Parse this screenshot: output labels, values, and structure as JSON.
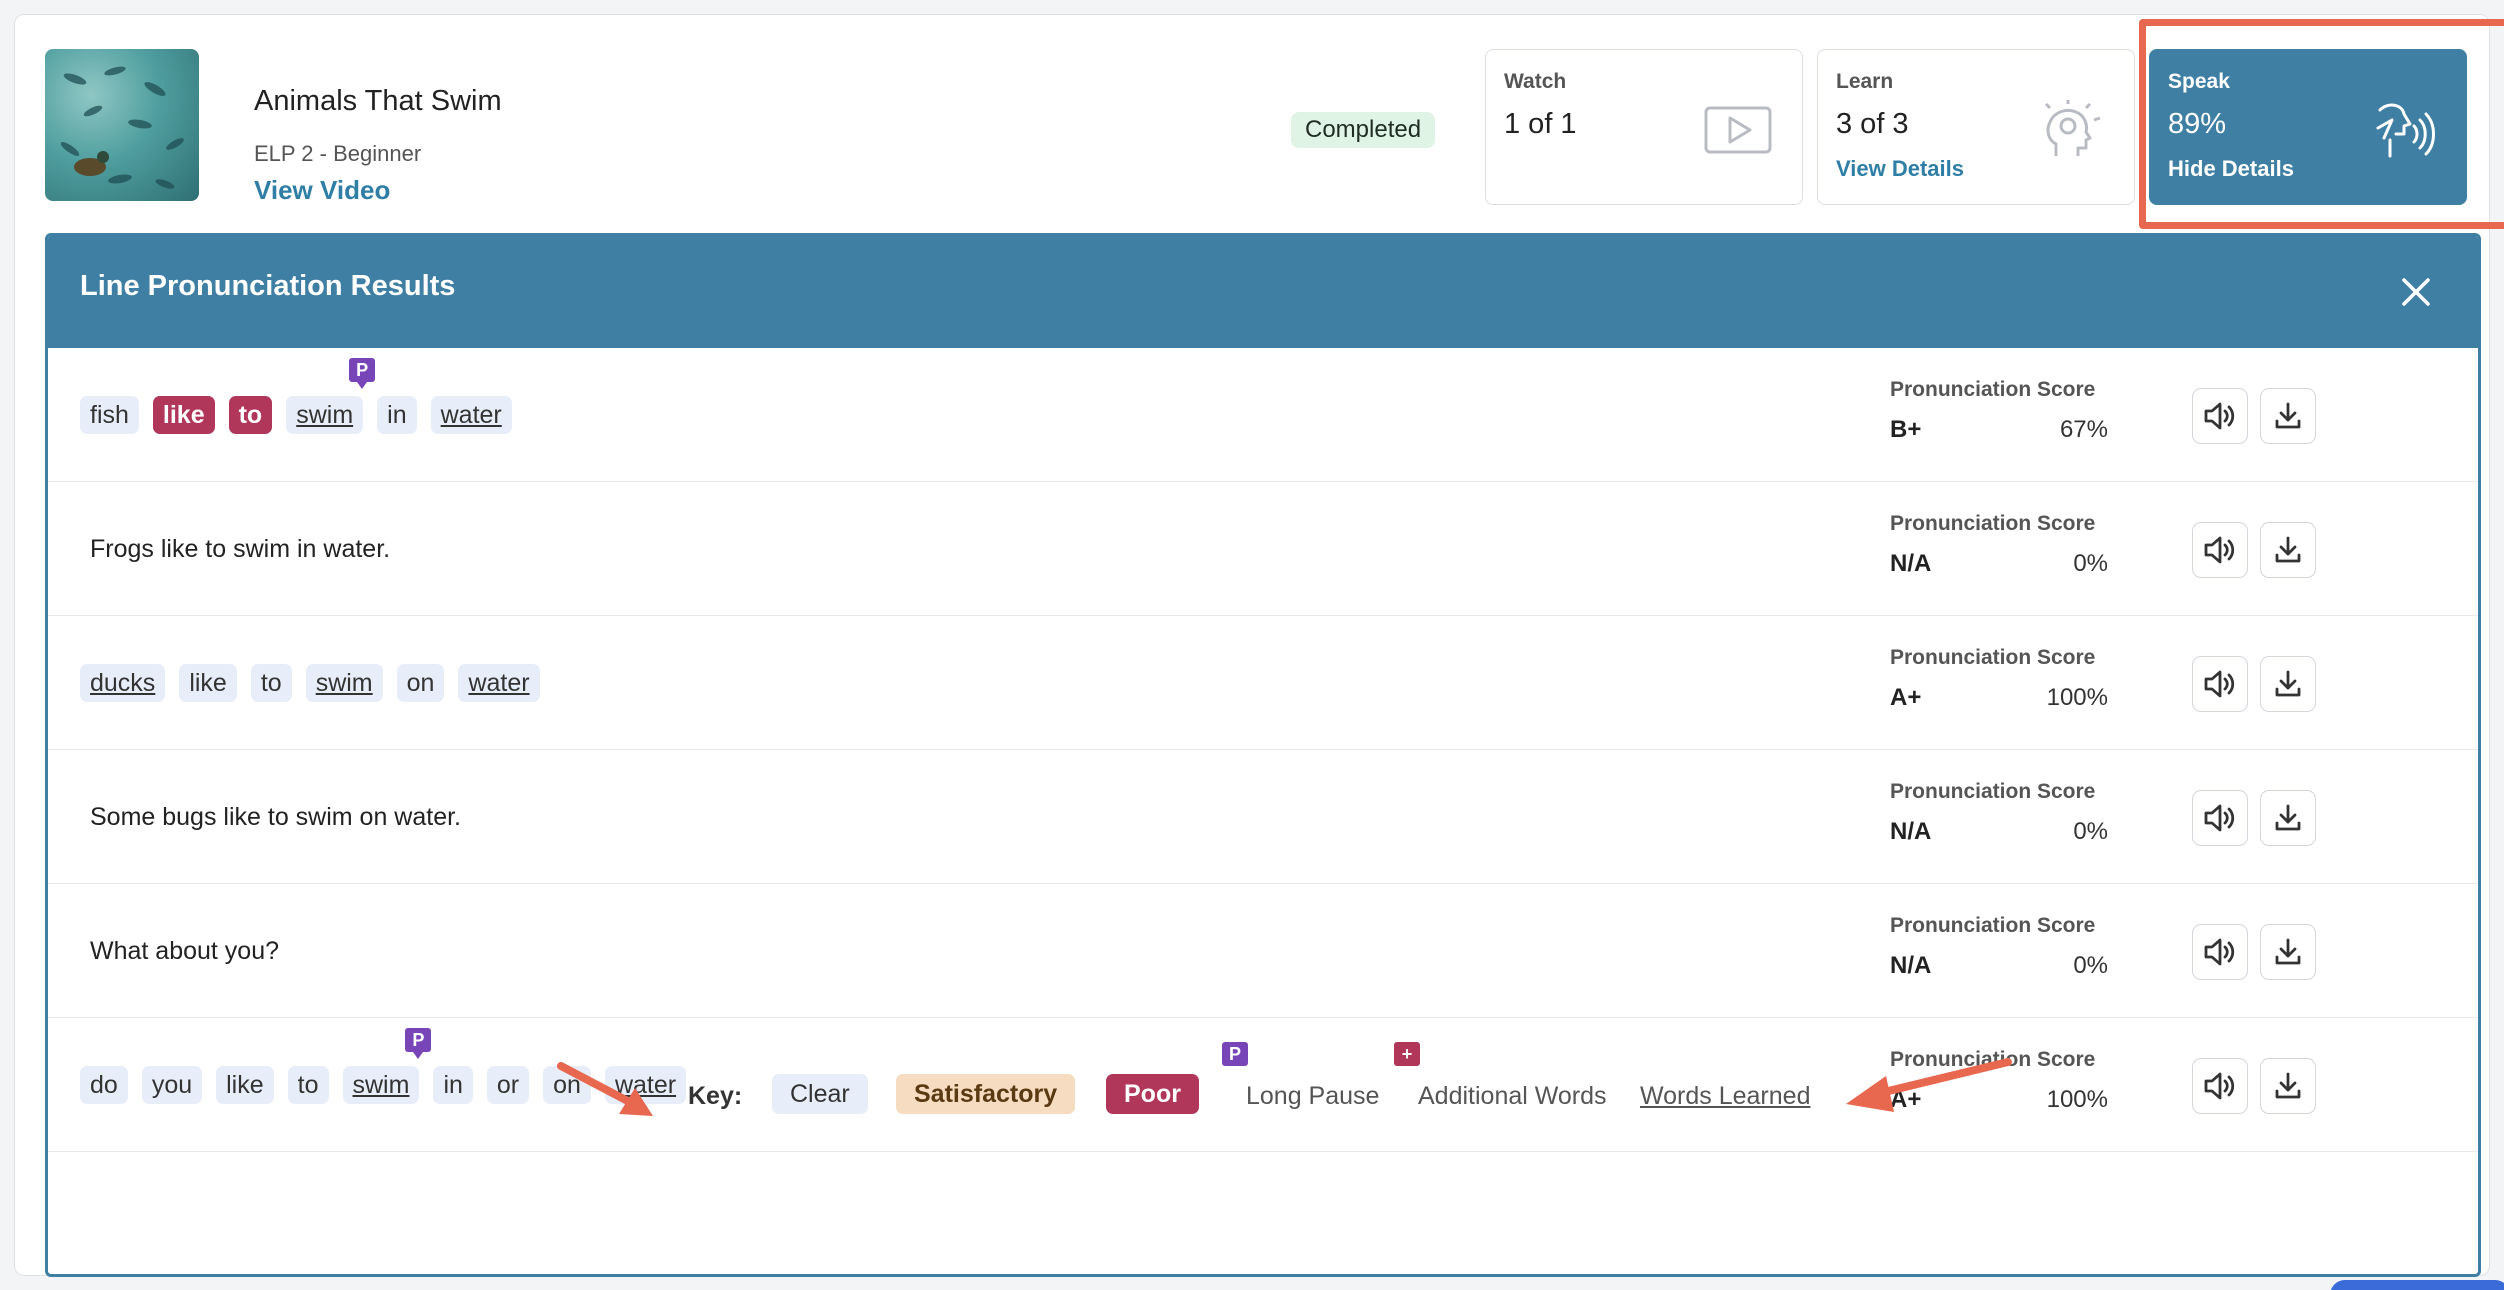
{
  "lesson": {
    "title": "Animals That Swim",
    "level": "ELP 2 - Beginner",
    "view_video_label": "View Video",
    "status": "Completed"
  },
  "stats": {
    "watch": {
      "label": "Watch",
      "value": "1 of 1",
      "icon": "play-icon"
    },
    "learn": {
      "label": "Learn",
      "value": "3 of 3",
      "link": "View Details",
      "icon": "head-lightbulb-icon"
    },
    "speak": {
      "label": "Speak",
      "value": "89%",
      "link": "Hide Details",
      "icon": "speaking-head-icon"
    }
  },
  "panel": {
    "title": "Line Pronunciation Results",
    "score_label": "Pronunciation Score",
    "rows": [
      {
        "type": "words",
        "words": [
          {
            "text": "fish",
            "status": "clear",
            "learned": false,
            "pause": false
          },
          {
            "text": "like",
            "status": "poor",
            "learned": false,
            "pause": false
          },
          {
            "text": "to",
            "status": "poor",
            "learned": false,
            "pause": false
          },
          {
            "text": "swim",
            "status": "clear",
            "learned": true,
            "pause": true
          },
          {
            "text": "in",
            "status": "clear",
            "learned": false,
            "pause": false
          },
          {
            "text": "water",
            "status": "clear",
            "learned": true,
            "pause": false
          }
        ],
        "grade": "B+",
        "percent": "67%"
      },
      {
        "type": "sentence",
        "text": "Frogs like to swim in water.",
        "grade": "N/A",
        "percent": "0%"
      },
      {
        "type": "words",
        "words": [
          {
            "text": "ducks",
            "status": "clear",
            "learned": true,
            "pause": false
          },
          {
            "text": "like",
            "status": "clear",
            "learned": false,
            "pause": false
          },
          {
            "text": "to",
            "status": "clear",
            "learned": false,
            "pause": false
          },
          {
            "text": "swim",
            "status": "clear",
            "learned": true,
            "pause": false
          },
          {
            "text": "on",
            "status": "clear",
            "learned": false,
            "pause": false
          },
          {
            "text": "water",
            "status": "clear",
            "learned": true,
            "pause": false
          }
        ],
        "grade": "A+",
        "percent": "100%"
      },
      {
        "type": "sentence",
        "text": "Some bugs like to swim on water.",
        "grade": "N/A",
        "percent": "0%"
      },
      {
        "type": "sentence",
        "text": "What about you?",
        "grade": "N/A",
        "percent": "0%"
      },
      {
        "type": "words",
        "words": [
          {
            "text": "do",
            "status": "clear",
            "learned": false,
            "pause": false
          },
          {
            "text": "you",
            "status": "clear",
            "learned": false,
            "pause": false
          },
          {
            "text": "like",
            "status": "clear",
            "learned": false,
            "pause": false
          },
          {
            "text": "to",
            "status": "clear",
            "learned": false,
            "pause": false
          },
          {
            "text": "swim",
            "status": "clear",
            "learned": true,
            "pause": true
          },
          {
            "text": "in",
            "status": "clear",
            "learned": false,
            "pause": false
          },
          {
            "text": "or",
            "status": "clear",
            "learned": false,
            "pause": false
          },
          {
            "text": "on",
            "status": "clear",
            "learned": false,
            "pause": false
          },
          {
            "text": "water",
            "status": "clear",
            "learned": true,
            "pause": false
          }
        ],
        "grade": "A+",
        "percent": "100%"
      }
    ],
    "pause_badge": "P"
  },
  "key": {
    "label": "Key:",
    "clear": "Clear",
    "satisfactory": "Satisfactory",
    "poor": "Poor",
    "long_pause": "Long Pause",
    "long_pause_badge": "P",
    "additional_words": "Additional Words",
    "additional_badge": "+",
    "words_learned": "Words Learned"
  },
  "colors": {
    "brand_blue": "#3f7fa3",
    "link_blue": "#2f7ea6",
    "poor": "#b0365a",
    "satisfactory": "#f6dcc0",
    "clear": "#e8eef9",
    "pause": "#7845b8",
    "highlight": "#e8674f"
  }
}
